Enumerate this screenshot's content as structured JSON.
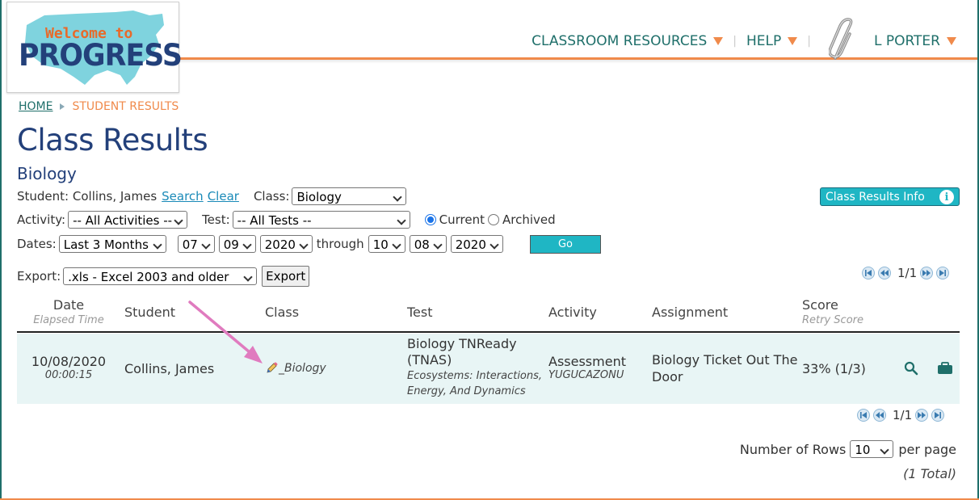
{
  "logo": {
    "line1": "Welcome to",
    "line2": "PROGRESS"
  },
  "nav": {
    "classroom_resources": "CLASSROOM RESOURCES",
    "help": "HELP",
    "user": "L PORTER"
  },
  "breadcrumb": {
    "home": "HOME",
    "current": "STUDENT RESULTS"
  },
  "page": {
    "title": "Class Results",
    "subtitle": "Biology"
  },
  "filters": {
    "student_label": "Student: Collins, James",
    "search_link": "Search",
    "clear_link": "Clear",
    "class_label": "Class:",
    "class_value": "Biology",
    "activity_label": "Activity:",
    "activity_value": "-- All Activities --",
    "test_label": "Test:",
    "test_value": "-- All Tests --",
    "radio_current": "Current",
    "radio_archived": "Archived",
    "dates_label": "Dates:",
    "dates_value": "Last 3 Months",
    "from_month": "07",
    "from_day": "09",
    "from_year": "2020",
    "through_label": "through",
    "to_month": "10",
    "to_day": "08",
    "to_year": "2020",
    "go_label": "Go"
  },
  "info_button": {
    "label": "Class Results Info"
  },
  "export": {
    "label": "Export:",
    "format_value": ".xls - Excel 2003 and older",
    "button_label": "Export"
  },
  "pager": {
    "text": "1/1"
  },
  "table": {
    "headers": {
      "date": "Date",
      "date_sub": "Elapsed Time",
      "student": "Student",
      "class": "Class",
      "test": "Test",
      "activity": "Activity",
      "assignment": "Assignment",
      "score": "Score",
      "score_sub": "Retry Score"
    },
    "rows": [
      {
        "date": "10/08/2020",
        "elapsed": "00:00:15",
        "student": "Collins, James",
        "class": "_Biology",
        "test_line1": "Biology TNReady",
        "test_line2": "(TNAS)",
        "test_sub1": "Ecosystems: Interactions,",
        "test_sub2": "Energy, And Dynamics",
        "activity": "Assessment",
        "activity_sub": "YUGUCAZONU",
        "assignment_line1": "Biology Ticket Out The",
        "assignment_line2": "Door",
        "score": "33% (1/3)"
      }
    ]
  },
  "footer": {
    "rows_label": "Number of Rows",
    "rows_value": "10",
    "per_page": "per page",
    "total": "(1 Total)"
  },
  "colors": {
    "teal": "#1f6f6a",
    "orange": "#f08a4b",
    "navy": "#23407a",
    "accent": "#1fb6c4",
    "row_bg": "#e8f5f5",
    "annotation_arrow": "#e07bbf"
  }
}
